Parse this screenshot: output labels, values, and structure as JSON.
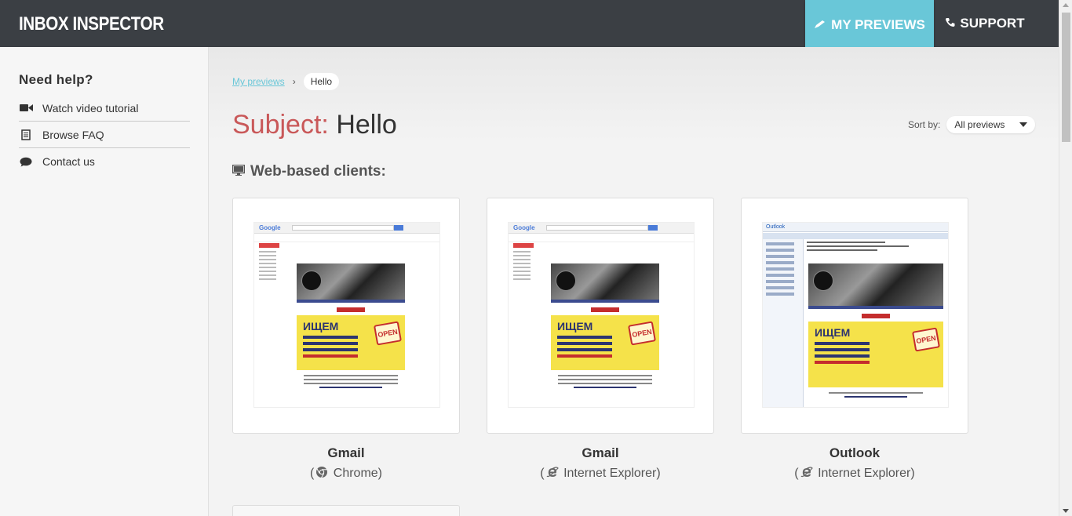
{
  "app": {
    "logo": "INBOX INSPECTOR",
    "nav": {
      "previews_label": "MY PREVIEWS",
      "support_label": "SUPPORT"
    }
  },
  "sidebar": {
    "title": "Need help?",
    "items": [
      {
        "label": "Watch video tutorial",
        "icon": "video-camera-icon"
      },
      {
        "label": "Browse FAQ",
        "icon": "document-icon"
      },
      {
        "label": "Contact us",
        "icon": "chat-bubble-icon"
      }
    ]
  },
  "breadcrumb": {
    "link": "My previews",
    "separator": "›",
    "current": "Hello"
  },
  "subject": {
    "label": "Subject:",
    "value": "Hello"
  },
  "sort": {
    "label": "Sort by:",
    "selected": "All previews"
  },
  "section": {
    "title": "Web-based clients:",
    "icon": "monitor-icon"
  },
  "clients": [
    {
      "name": "Gmail",
      "open_paren": "(",
      "browser": "Chrome",
      "close_paren": ")",
      "browser_icon": "chrome-icon"
    },
    {
      "name": "Gmail",
      "open_paren": "(",
      "browser": "Internet Explorer",
      "close_paren": ")",
      "browser_icon": "ie-icon"
    },
    {
      "name": "Outlook",
      "open_paren": "(",
      "browser": "Internet Explorer",
      "close_paren": ")",
      "browser_icon": "ie-icon"
    }
  ],
  "preview_email": {
    "headline": "ИЩЕМ",
    "badge": "OPEN",
    "outlook_logo": "Outlook",
    "gmail_logo": "Google"
  },
  "colors": {
    "topbar": "#3b3f44",
    "accent": "#69c7d8",
    "subject_label": "#c95859"
  }
}
